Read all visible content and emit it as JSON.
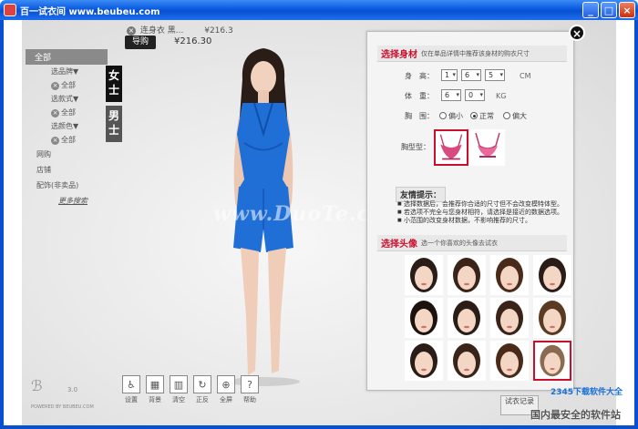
{
  "window": {
    "title": "百一试衣间 www.beubeu.com",
    "minimize": "_",
    "maximize": "□",
    "close": "×"
  },
  "topbar": {
    "item_name": "连身衣 黑...",
    "item_price": "¥216.3",
    "buy_label": "导购",
    "total_price": "¥216.30"
  },
  "menu": {
    "all": "全部",
    "style_filter": "选品牌▼",
    "style_all": "全部",
    "type_filter": "选款式▼",
    "type_all": "全部",
    "color_filter": "选颜色▼",
    "color_all": "全部",
    "categories": [
      "网购",
      "店铺",
      "配饰(非卖品)"
    ],
    "more_link": "更多搜索"
  },
  "gender": {
    "female": "女士",
    "male": "男士"
  },
  "watermark": "www.DuoTe.com",
  "logo": {
    "version": "3.0",
    "powered": "POWERED BY BEUBEU.COM"
  },
  "toolbar": [
    {
      "label": "设置",
      "icon": "settings-icon"
    },
    {
      "label": "背景",
      "icon": "background-icon"
    },
    {
      "label": "清空",
      "icon": "clear-icon"
    },
    {
      "label": "正反",
      "icon": "rotate-icon"
    },
    {
      "label": "全屏",
      "icon": "fullscreen-icon"
    },
    {
      "label": "帮助",
      "icon": "help-icon"
    }
  ],
  "panel": {
    "close": "×",
    "body_section": {
      "title": "选择身材",
      "desc": "仅在单品详情中推荐该身材的购衣尺寸"
    },
    "height_label": "身　高：",
    "height_values": [
      "1",
      "6",
      "5"
    ],
    "height_unit": "CM",
    "weight_label": "体　重：",
    "weight_values": [
      "6",
      "0"
    ],
    "weight_unit": "KG",
    "chest_label": "胸　围：",
    "chest_options": [
      "偏小",
      "正常",
      "偏大"
    ],
    "chest_selected": "正常",
    "bra_label": "胸型型：",
    "tips_title": "友情提示：",
    "tips": [
      "选择数据后，会推荐你合适的尺寸但不会改变模特体型。",
      "若选项不完全与您身材相符，请选择是接近的数据选项。",
      "小范围的改变身材数据，不影响推荐的尺寸。"
    ],
    "head_section": {
      "title": "选择头像",
      "desc": "选一个你喜欢的头像去试衣"
    }
  },
  "try_button": "试衣记录",
  "brand": {
    "site": "2345下载软件大全",
    "slogan": "国内最安全的软件站"
  }
}
